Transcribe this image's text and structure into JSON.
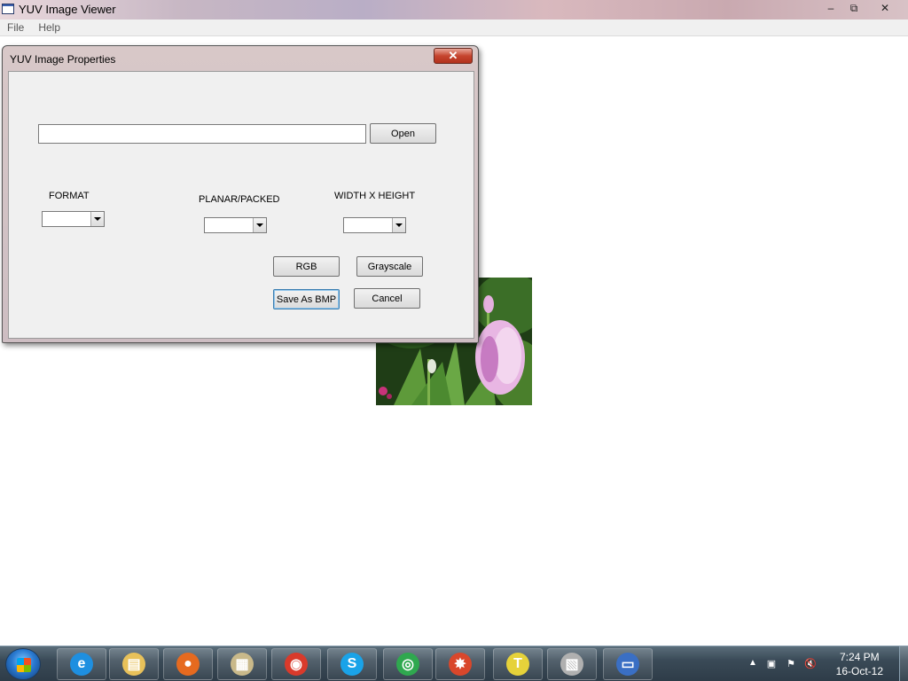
{
  "window": {
    "title": "YUV Image Viewer",
    "controls": {
      "minimize": "‒",
      "maximize": "⧉",
      "close": "✕"
    }
  },
  "menu": {
    "items": [
      {
        "label": "File"
      },
      {
        "label": "Help"
      }
    ]
  },
  "dialog": {
    "title": "YUV Image Properties",
    "close_label": "✕",
    "file_path": {
      "value": "",
      "placeholder": ""
    },
    "open_label": "Open",
    "format": {
      "label": "FORMAT",
      "selected": ""
    },
    "planar_packed": {
      "label": "PLANAR/PACKED",
      "selected": ""
    },
    "size": {
      "label": "WIDTH X HEIGHT",
      "selected": ""
    },
    "rgb_label": "RGB",
    "grayscale_label": "Grayscale",
    "save_bmp_label": "Save As BMP",
    "cancel_label": "Cancel"
  },
  "taskbar": {
    "pinned": [
      {
        "name": "internet-explorer-icon",
        "glyph": "e",
        "color": "#1e8fe0"
      },
      {
        "name": "file-explorer-icon",
        "glyph": "▤",
        "color": "#e8c15a"
      },
      {
        "name": "firefox-icon",
        "glyph": "●",
        "color": "#e66a1f"
      },
      {
        "name": "folder-icon",
        "glyph": "▦",
        "color": "#c9b98a"
      },
      {
        "name": "chrome-icon",
        "glyph": "◉",
        "color": "#d93a2b"
      },
      {
        "name": "skype-icon",
        "glyph": "S",
        "color": "#1aa3e8"
      },
      {
        "name": "green-app-icon",
        "glyph": "◎",
        "color": "#2fa84f"
      },
      {
        "name": "paint-app-icon",
        "glyph": "✸",
        "color": "#d9472b"
      },
      {
        "name": "text-editor-icon",
        "glyph": "T",
        "color": "#e6d23a"
      },
      {
        "name": "app-window-icon",
        "glyph": "▧",
        "color": "#b0b0b0"
      },
      {
        "name": "yuv-viewer-taskbar-icon",
        "glyph": "▭",
        "color": "#3a6fc4"
      }
    ],
    "tray": {
      "arrow": "▲",
      "icons": [
        "network-icon",
        "flag-icon",
        "volume-muted-icon"
      ]
    },
    "clock": {
      "time": "7:24 PM",
      "date": "16-Oct-12"
    }
  }
}
